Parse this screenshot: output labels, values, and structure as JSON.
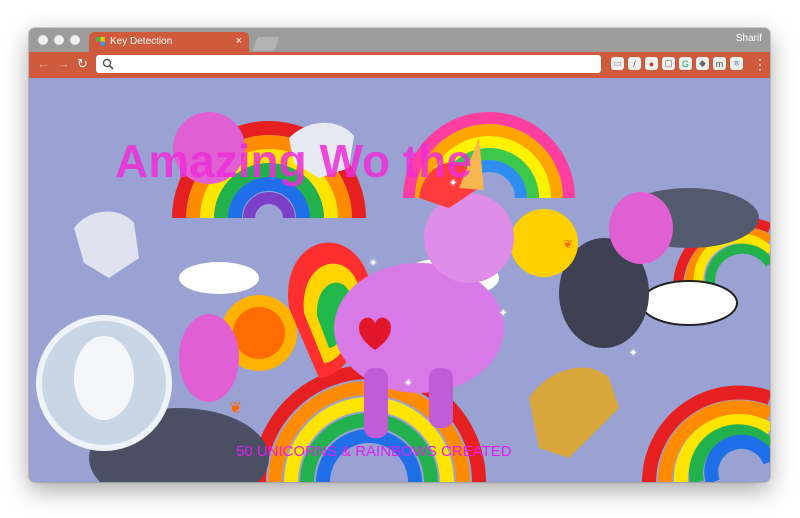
{
  "browser": {
    "tab_title": "Key Detection",
    "tab_close": "×",
    "user_name": "Sharif",
    "nav_back": "←",
    "nav_forward": "→",
    "nav_reload": "↻",
    "address_value": "",
    "menu": "⋮",
    "extensions": [
      {
        "name": "ext-reader-icon",
        "glyph": "▭",
        "color": "#8a8a8a"
      },
      {
        "name": "ext-eyedropper-icon",
        "glyph": "/",
        "color": "#555555"
      },
      {
        "name": "ext-record-icon",
        "glyph": "●",
        "color": "#c0392b"
      },
      {
        "name": "ext-window-icon",
        "glyph": "▢",
        "color": "#666666"
      },
      {
        "name": "ext-grammarly-icon",
        "glyph": "G",
        "color": "#1fa463"
      },
      {
        "name": "ext-tag-icon",
        "glyph": "◆",
        "color": "#666666"
      },
      {
        "name": "ext-m-icon",
        "glyph": "m",
        "color": "#444444"
      },
      {
        "name": "ext-react-icon",
        "glyph": "⚛",
        "color": "#2c5d9c"
      }
    ]
  },
  "page": {
    "headline": "Amazing Wo    the",
    "counter": "50 UNICORNS & RAINBOWS CREATED"
  },
  "colors": {
    "toolbar": "#cf5a3c",
    "background": "#9aa2d3",
    "headline": "#ee2dd8",
    "counter": "#e31ff0"
  }
}
